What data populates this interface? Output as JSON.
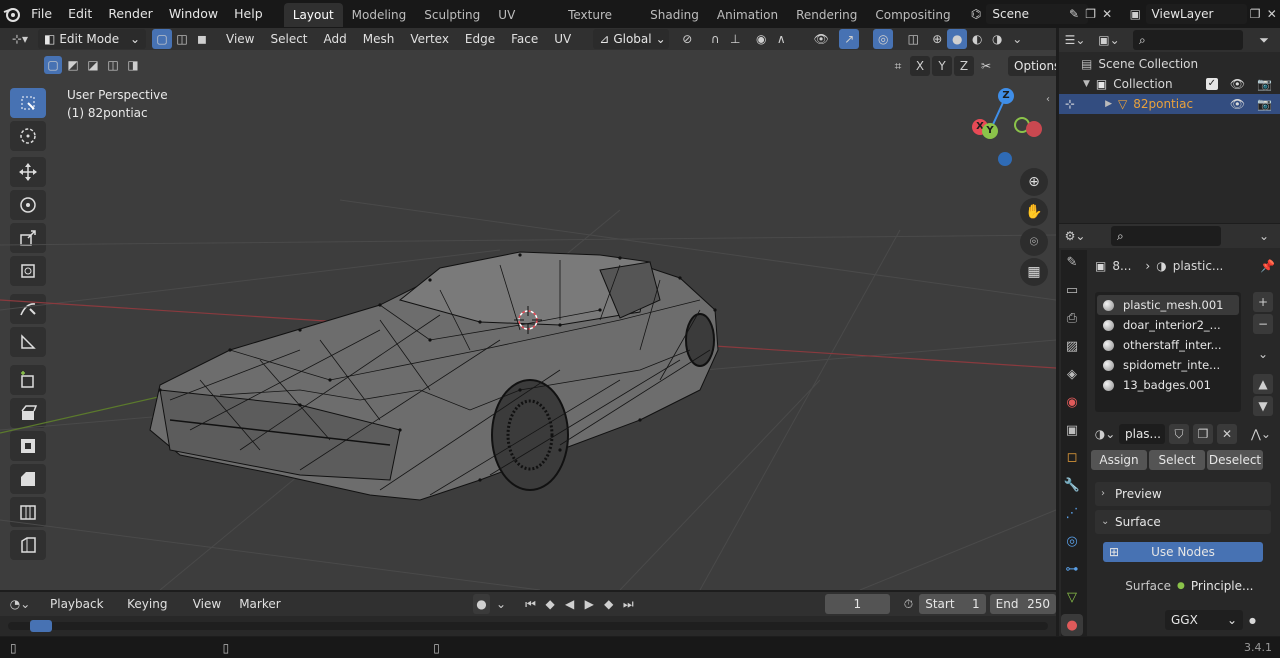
{
  "menus": [
    "File",
    "Edit",
    "Render",
    "Window",
    "Help"
  ],
  "workspaces": [
    "Layout",
    "Modeling",
    "Sculpting",
    "UV Editing",
    "Texture Paint",
    "Shading",
    "Animation",
    "Rendering",
    "Compositing"
  ],
  "scene": "Scene",
  "view_layer": "ViewLayer",
  "viewport": {
    "mode": "Edit Mode",
    "menus": [
      "View",
      "Select",
      "Add",
      "Mesh",
      "Vertex",
      "Edge",
      "Face",
      "UV"
    ],
    "transform_orientation": "Global",
    "options_label": "Options",
    "axis_locks": [
      "X",
      "Y",
      "Z"
    ],
    "overlay_title": "User Perspective",
    "overlay_object": "(1) 82pontiac",
    "gizmo": {
      "z": "Z",
      "x": "X",
      "y": "Y"
    }
  },
  "outliner": {
    "root": "Scene Collection",
    "collection": "Collection",
    "object": "82pontiac"
  },
  "properties": {
    "breadcrumb_object": "8...",
    "breadcrumb_material": "plastic...",
    "materials": [
      "plastic_mesh.001",
      "doar_interior2_...",
      "otherstaff_inter...",
      "spidometr_inte...",
      "13_badges.001"
    ],
    "active_material": "plas...",
    "assign": "Assign",
    "select": "Select",
    "deselect": "Deselect",
    "preview": "Preview",
    "surface_panel": "Surface",
    "use_nodes": "Use Nodes",
    "surface_label": "Surface",
    "surface_value": "Principle...",
    "distribution": "GGX"
  },
  "timeline": {
    "menus": [
      "Playback",
      "Keying",
      "View",
      "Marker"
    ],
    "current_frame": "1",
    "start_label": "Start",
    "start_value": "1",
    "end_label": "End",
    "end_value": "250"
  },
  "status": {
    "version": "3.4.1"
  },
  "colors": {
    "accent": "#4772b3",
    "object_orange": "#e9a13b",
    "x_axis": "#e84a56",
    "y_axis": "#8bc34a",
    "z_axis": "#3f8ee8"
  }
}
